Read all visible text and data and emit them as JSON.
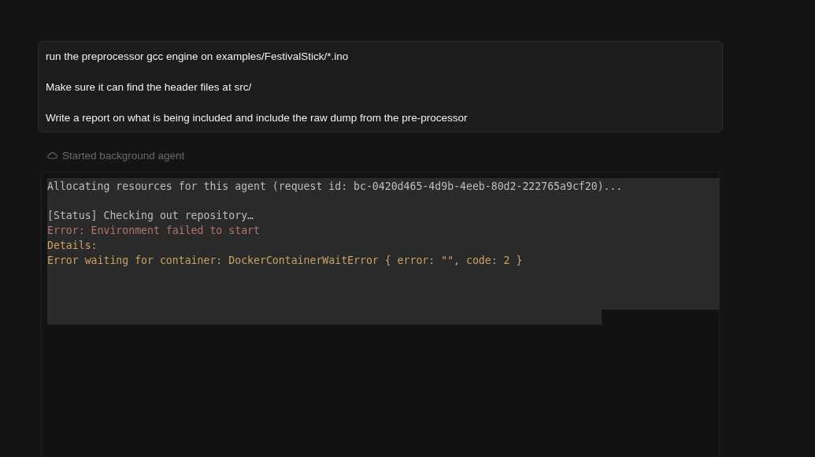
{
  "prompt": {
    "lines": [
      "run the preprocessor gcc engine on examples/FestivalStick/*.ino",
      "Make sure it can find the header files at src/",
      "Write a report on what is being included and include the raw dump from the pre-processor"
    ]
  },
  "status": {
    "label": "Started background agent"
  },
  "log": [
    {
      "kind": "info",
      "text": "Allocating resources for this agent (request id: bc-0420d465-4d9b-4eeb-80d2-222765a9cf20)..."
    },
    {
      "kind": "status",
      "text": "[Status] Checking out repository…"
    },
    {
      "kind": "error",
      "text": "Error: Environment failed to start"
    },
    {
      "kind": "detail",
      "text": "Details:"
    },
    {
      "kind": "detail",
      "text": "Error waiting for container: DockerContainerWaitError { error: \"\", code: 2 }"
    }
  ]
}
